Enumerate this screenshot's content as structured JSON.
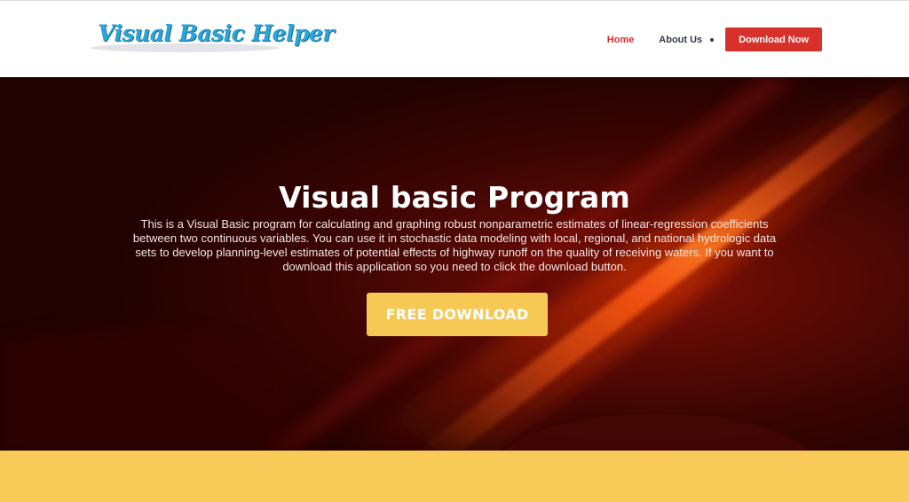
{
  "header": {
    "logo_text": "Visual Basic Helper",
    "nav": {
      "home": "Home",
      "about": "About Us",
      "download": "Download Now"
    }
  },
  "hero": {
    "title": "Visual basic Program",
    "description": "This is a Visual Basic program for calculating and graphing robust nonparametric estimates of linear-regression coefficients between two continuous variables. You can use it in stochastic data modeling with local, regional, and national hydrologic data sets to develop planning-level estimates of potential effects of highway runoff on the quality of receiving waters. If you want to download this application so you need to click the download button.",
    "cta": "FREE DOWNLOAD"
  },
  "colors": {
    "accent_red": "#d8302a",
    "cta_yellow": "#f6c955",
    "band_yellow": "#f8ca58",
    "hero_dark": "#2e0403",
    "logo_blue": "#2ea3d6"
  }
}
